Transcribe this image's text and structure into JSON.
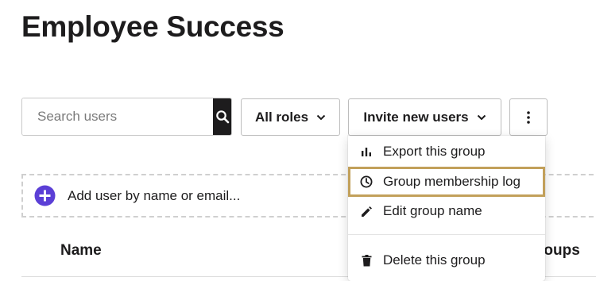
{
  "page": {
    "title": "Employee Success"
  },
  "toolbar": {
    "search_placeholder": "Search users",
    "roles_label": "All roles",
    "invite_label": "Invite new users"
  },
  "menu": {
    "items": [
      {
        "label": "Export this group",
        "icon": "bar-chart-icon"
      },
      {
        "label": "Group membership log",
        "icon": "clock-icon",
        "highlighted": true
      },
      {
        "label": "Edit group name",
        "icon": "pencil-icon"
      },
      {
        "label": "Delete this group",
        "icon": "trash-icon"
      }
    ]
  },
  "add_user": {
    "label": "Add user by name or email...",
    "icon": "plus-circle-icon"
  },
  "table": {
    "columns": [
      "Name",
      "roups"
    ]
  },
  "colors": {
    "accent": "#5b3fd6",
    "highlight_border": "#c2a05a",
    "dark": "#1d1c1d"
  }
}
